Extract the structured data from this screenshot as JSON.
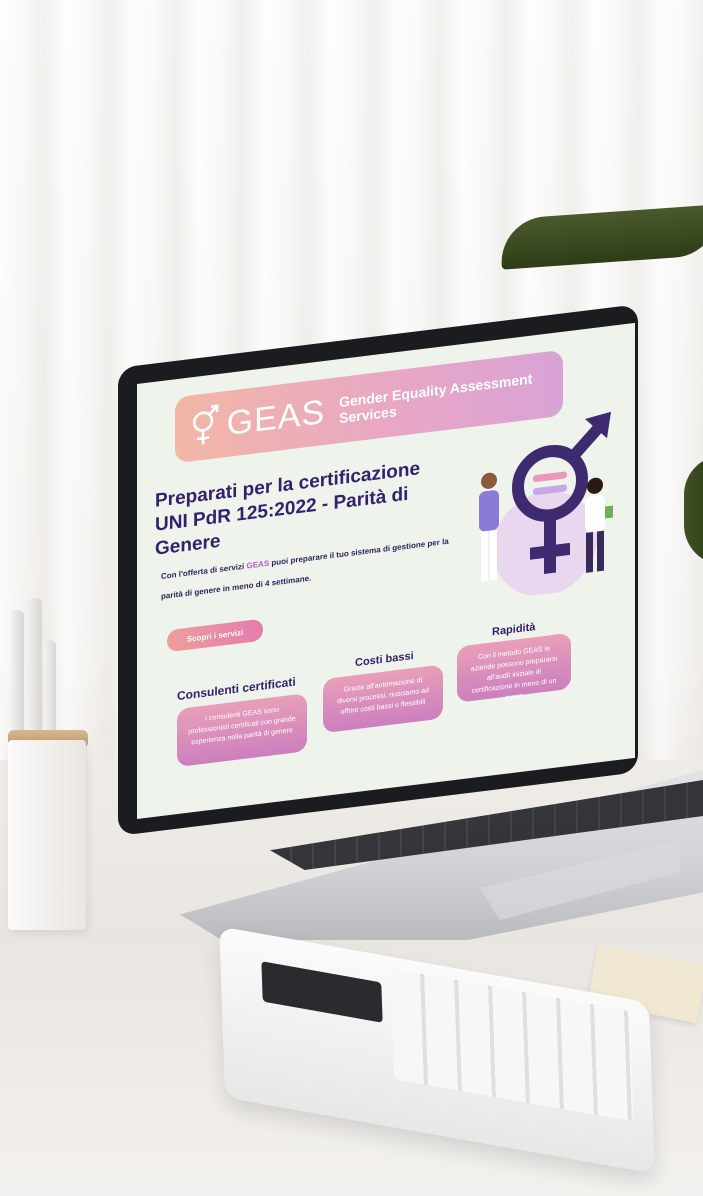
{
  "website": {
    "brand": "GEAS",
    "brand_subtitle": "Gender Equality Assessment Services",
    "headline_line1": "Preparati per la certificazione",
    "headline_line2": "UNI PdR 125:2022 - Parità di Genere",
    "intro_before": "Con l'offerta di servizi ",
    "intro_highlight": "GEAS",
    "intro_after": " puoi preparare il tuo sistema di gestione per la parità di genere in meno di 4 settimane.",
    "cta_label": "Scopri i servizi",
    "features": [
      {
        "title": "Consulenti certificati",
        "text": "I consulenti GEAS sono professionisti certificati con grande esperienza nella parità di genere"
      },
      {
        "title": "Costi bassi",
        "text": "Grazie all'automazione di diversi processi, riusciamo ad offrire costi bassi e flessibili"
      },
      {
        "title": "Rapidità",
        "text": "Con il metodo GEAS le aziende possono prepararsi all'audit iniziale di certificazione in meno di un mese"
      }
    ]
  },
  "colors": {
    "headline": "#35206b",
    "accent": "#b35bd0",
    "header_gradient_start": "#f2b7a6",
    "header_gradient_end": "#d9a3d6"
  },
  "icons": [
    "gender-symbol-icon",
    "gender-equality-illustration"
  ]
}
